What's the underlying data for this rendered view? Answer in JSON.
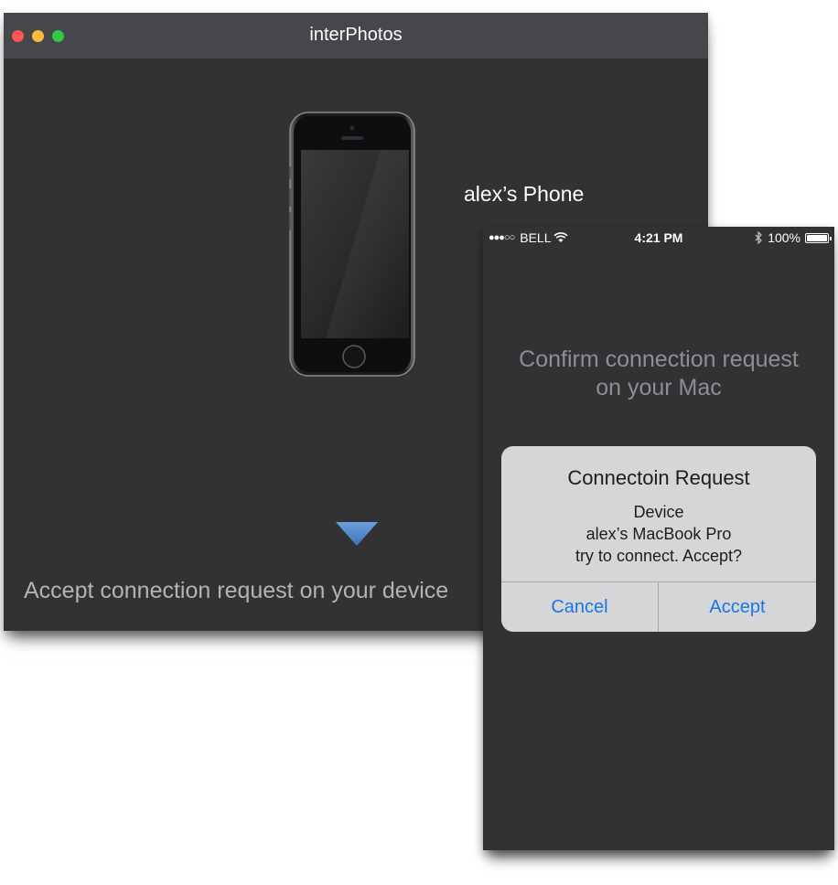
{
  "mac_window": {
    "title": "interPhotos",
    "device_name": "alex’s Phone",
    "instruction": "Accept connection request on your device",
    "arrow_icon": "triangle-down-icon",
    "colors": {
      "background": "#323234",
      "titlebar": "#46474b",
      "arrow": "#5a8fcf"
    }
  },
  "phone": {
    "status_bar": {
      "signal": "●●●○○",
      "carrier": "BELL",
      "wifi_icon": "wifi-icon",
      "time": "4:21 PM",
      "bluetooth_icon": "bluetooth-icon",
      "battery": "100%"
    },
    "confirm_line1": "Confirm connection request",
    "confirm_line2": "on your Mac",
    "alert": {
      "title": "Connectoin Request",
      "line1": "Device",
      "line2": "alex’s MacBook Pro",
      "line3": "try to connect. Accept?",
      "cancel_label": "Cancel",
      "accept_label": "Accept"
    },
    "colors": {
      "accent": "#1677e4",
      "alert_bg": "#d6d6d9"
    }
  }
}
